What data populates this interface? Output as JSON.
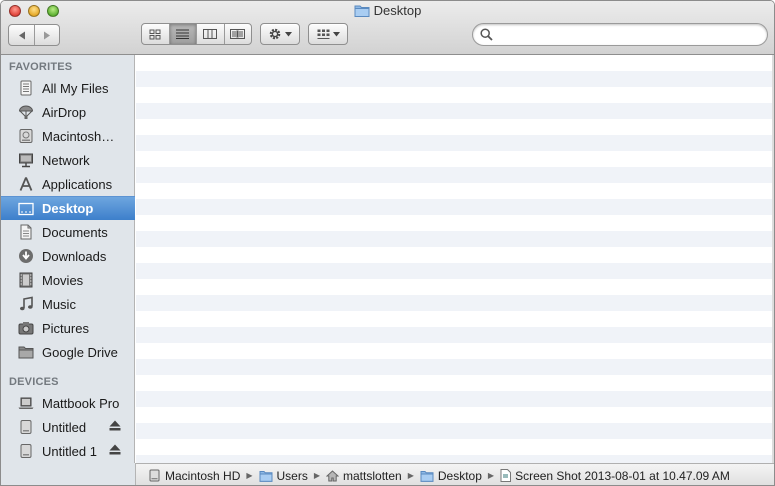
{
  "window": {
    "title": "Desktop"
  },
  "toolbar": {
    "search": {
      "value": "",
      "placeholder": ""
    }
  },
  "sidebar": {
    "favorites_header": "FAVORITES",
    "devices_header": "DEVICES",
    "favorites": [
      {
        "label": "All My Files",
        "icon": "all-files-icon"
      },
      {
        "label": "AirDrop",
        "icon": "airdrop-icon"
      },
      {
        "label": "Macintosh…",
        "icon": "hard-drive-icon"
      },
      {
        "label": "Network",
        "icon": "network-icon"
      },
      {
        "label": "Applications",
        "icon": "applications-icon"
      },
      {
        "label": "Desktop",
        "icon": "desktop-icon"
      },
      {
        "label": "Documents",
        "icon": "documents-icon"
      },
      {
        "label": "Downloads",
        "icon": "downloads-icon"
      },
      {
        "label": "Movies",
        "icon": "movies-icon"
      },
      {
        "label": "Music",
        "icon": "music-icon"
      },
      {
        "label": "Pictures",
        "icon": "pictures-icon"
      },
      {
        "label": "Google Drive",
        "icon": "folder-icon"
      }
    ],
    "devices": [
      {
        "label": "Mattbook Pro",
        "icon": "laptop-icon"
      },
      {
        "label": "Untitled",
        "icon": "disk-icon"
      },
      {
        "label": "Untitled 1",
        "icon": "disk-icon"
      }
    ]
  },
  "pathbar": {
    "items": [
      "Macintosh HD",
      "Users",
      "mattslotten",
      "Desktop",
      "Screen Shot 2013-08-01 at 10.47.09 AM"
    ]
  },
  "colors": {
    "selection": "#3d7fcb",
    "sidebar_bg": "#e0e5ea",
    "stripe": "#f0f3f8"
  }
}
